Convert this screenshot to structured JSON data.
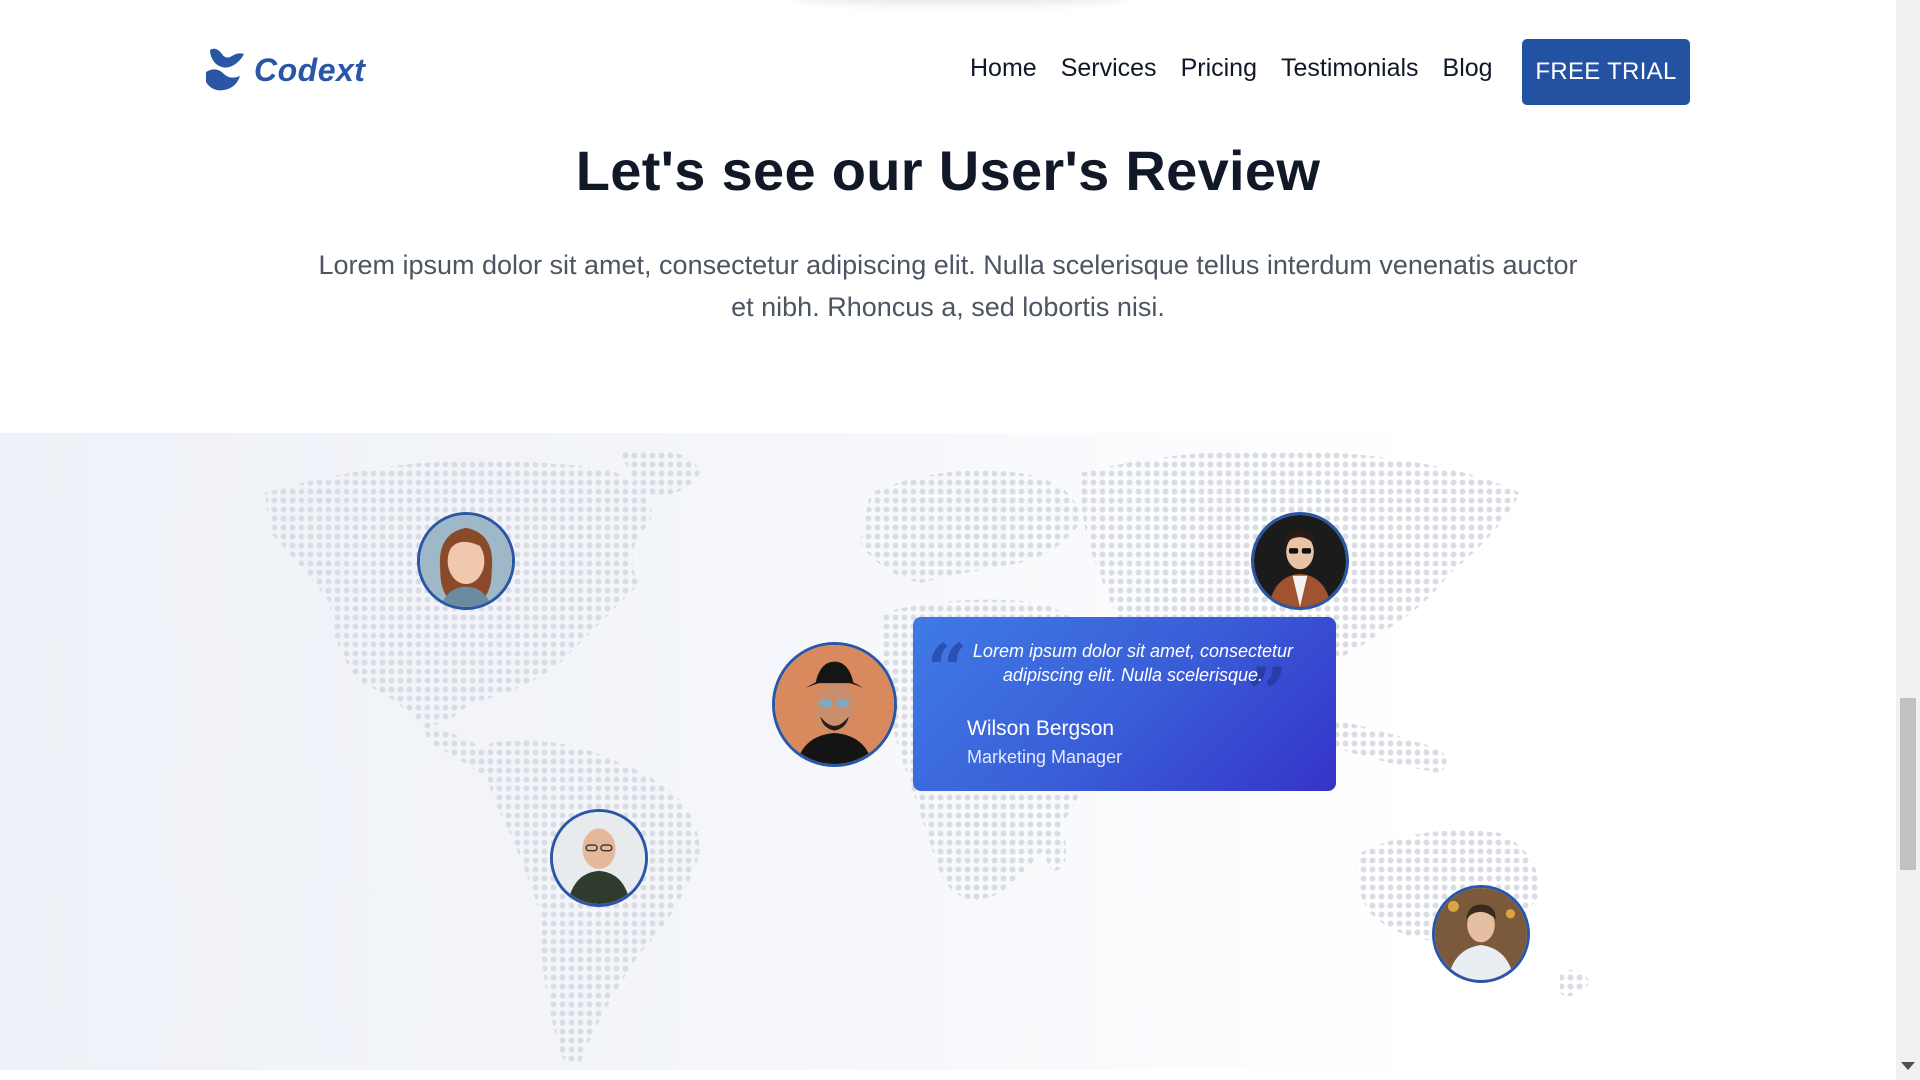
{
  "header": {
    "logo_text": "Codext",
    "logo_icon": "codext-logo-icon",
    "nav": [
      {
        "label": "Home"
      },
      {
        "label": "Services"
      },
      {
        "label": "Pricing"
      },
      {
        "label": "Testimonials"
      },
      {
        "label": "Blog"
      }
    ],
    "cta_label": "FREE TRIAL"
  },
  "intro": {
    "title": "Let's see our User's Review",
    "subtitle": "Lorem ipsum dolor sit amet, consectetur adipiscing elit. Nulla scelerisque tellus interdum venenatis auctor et nibh. Rhoncus a, sed lobortis nisi."
  },
  "testimonial": {
    "quote": "Lorem ipsum dolor sit amet, consectetur adipiscing elit. Nulla scelerisque.",
    "open_quote_mark": "“",
    "close_quote_mark": "”",
    "name": "Wilson Bergson",
    "role": "Marketing Manager"
  },
  "avatars": [
    {
      "name": "user-avatar-north-america",
      "description_icon": "woman-portrait"
    },
    {
      "name": "user-avatar-south-america",
      "description_icon": "bald-man-portrait"
    },
    {
      "name": "user-avatar-africa-active",
      "description_icon": "man-hat-portrait"
    },
    {
      "name": "user-avatar-asia",
      "description_icon": "man-sunglasses-portrait"
    },
    {
      "name": "user-avatar-australia",
      "description_icon": "man-white-shirt-portrait"
    }
  ],
  "colors": {
    "brand": "#2a56a6",
    "cta_bg": "#2452a3",
    "card_gradient_start": "#3f7ae6",
    "card_gradient_end": "#3533c9",
    "text_dark": "#111827",
    "text_muted": "#4b5563",
    "map_dots": "#d9dce3"
  }
}
